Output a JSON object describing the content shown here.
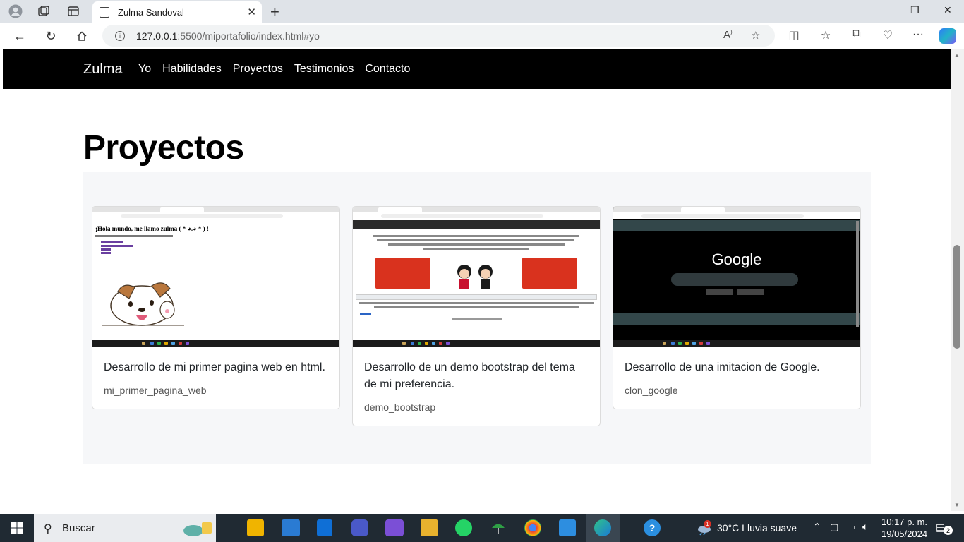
{
  "browser": {
    "tab_title": "Zulma Sandoval",
    "url_host": "127.0.0.1",
    "url_rest": ":5500/miportafolio/index.html#yo"
  },
  "navbar": {
    "brand": "Zulma",
    "links": [
      "Yo",
      "Habilidades",
      "Proyectos",
      "Testimonios",
      "Contacto"
    ]
  },
  "section": {
    "heading": "Proyectos"
  },
  "cards": [
    {
      "title": "Desarrollo de mi primer pagina web en html.",
      "subtitle": "mi_primer_pagina_web",
      "shot_heading": "¡Hola mundo, me llamo zulma ( * ◕.◕ * ) !"
    },
    {
      "title": "Desarrollo de un demo bootstrap del tema de mi preferencia.",
      "subtitle": "demo_bootstrap"
    },
    {
      "title": "Desarrollo de una imitacion de Google.",
      "subtitle": "clon_google",
      "shot_logo": "Google"
    }
  ],
  "taskbar": {
    "search_label": "Buscar",
    "weather": "30°C  Lluvia suave",
    "time": "10:17 p. m.",
    "date": "19/05/2024",
    "notification_count": "2",
    "weather_badge": "1"
  }
}
